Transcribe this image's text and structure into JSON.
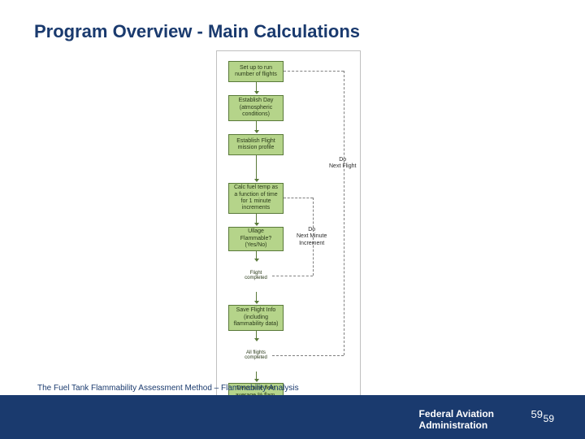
{
  "title": "Program Overview - Main Calculations",
  "flowchart": {
    "boxes": [
      {
        "id": "b1",
        "text": "Set up to run\nnumber of flights"
      },
      {
        "id": "b2",
        "text": "Establish Day\n(atmospheric\nconditions)"
      },
      {
        "id": "b3",
        "text": "Establish Flight\nmission profile"
      },
      {
        "id": "b4",
        "text": "Calc fuel temp as\na function of time\nfor 1 minute\nincrements"
      },
      {
        "id": "b5",
        "text": "Ullage\nFlammable?\n(Yes/No)"
      },
      {
        "id": "b6",
        "text": "Save Flight Info\n(including\nflammability data)"
      },
      {
        "id": "b7",
        "text": "Determine fleet\naverage % flam.\nStore results"
      }
    ],
    "diamonds": [
      {
        "id": "d1",
        "text": "Flight completed"
      },
      {
        "id": "d2",
        "text": "All flights completed"
      }
    ],
    "side_labels": [
      {
        "id": "s1",
        "text": "Do\nNext Flight"
      },
      {
        "id": "s2",
        "text": "Do\nNext Minute\nIncrement"
      }
    ]
  },
  "footer": {
    "left": "The Fuel Tank Flammability Assessment Method – Flammability Analysis",
    "agency_line1": "Federal Aviation",
    "agency_line2": "Administration",
    "page_a": "59",
    "page_b": "59"
  }
}
